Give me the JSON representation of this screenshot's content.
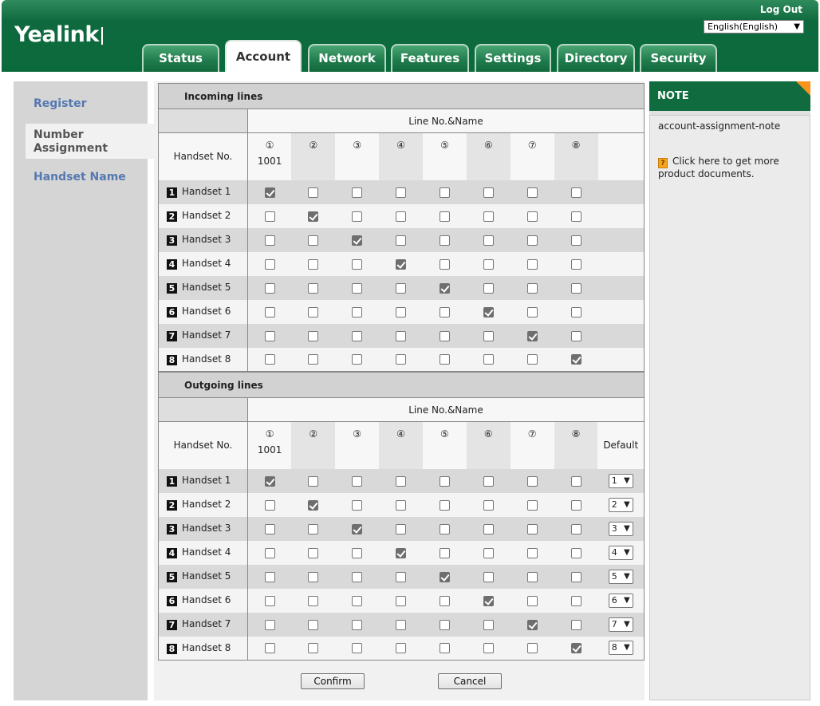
{
  "header": {
    "logo": "Yealink",
    "logout": "Log Out",
    "language": "English(English)",
    "tabs": [
      "Status",
      "Account",
      "Network",
      "Features",
      "Settings",
      "Directory",
      "Security"
    ],
    "active_tab": "Account"
  },
  "sidebar": {
    "items": [
      "Register",
      "Number Assignment",
      "Handset Name"
    ],
    "active": "Number Assignment"
  },
  "incoming": {
    "title": "Incoming lines",
    "line_header": "Line No.&Name",
    "handset_header": "Handset No.",
    "lines": [
      "①",
      "②",
      "③",
      "④",
      "⑤",
      "⑥",
      "⑦",
      "⑧"
    ],
    "line_names": [
      "1001",
      "",
      "",
      "",
      "",
      "",
      "",
      ""
    ],
    "handsets": [
      "Handset 1",
      "Handset 2",
      "Handset 3",
      "Handset 4",
      "Handset 5",
      "Handset 6",
      "Handset 7",
      "Handset 8"
    ],
    "handset_numbers": [
      "1",
      "2",
      "3",
      "4",
      "5",
      "6",
      "7",
      "8"
    ],
    "checked": [
      [
        0
      ],
      [
        1
      ],
      [
        2
      ],
      [
        3
      ],
      [
        4
      ],
      [
        5
      ],
      [
        6
      ],
      [
        7
      ]
    ]
  },
  "outgoing": {
    "title": "Outgoing lines",
    "line_header": "Line No.&Name",
    "handset_header": "Handset No.",
    "default_header": "Default",
    "lines": [
      "①",
      "②",
      "③",
      "④",
      "⑤",
      "⑥",
      "⑦",
      "⑧"
    ],
    "line_names": [
      "1001",
      "",
      "",
      "",
      "",
      "",
      "",
      ""
    ],
    "handsets": [
      "Handset 1",
      "Handset 2",
      "Handset 3",
      "Handset 4",
      "Handset 5",
      "Handset 6",
      "Handset 7",
      "Handset 8"
    ],
    "handset_numbers": [
      "1",
      "2",
      "3",
      "4",
      "5",
      "6",
      "7",
      "8"
    ],
    "checked": [
      [
        0
      ],
      [
        1
      ],
      [
        2
      ],
      [
        3
      ],
      [
        4
      ],
      [
        5
      ],
      [
        6
      ],
      [
        7
      ]
    ],
    "defaults": [
      "1",
      "2",
      "3",
      "4",
      "5",
      "6",
      "7",
      "8"
    ]
  },
  "buttons": {
    "confirm": "Confirm",
    "cancel": "Cancel"
  },
  "note": {
    "title": "NOTE",
    "text": "account-assignment-note",
    "link": "Click here to get more product documents.",
    "link_icon": "help-icon"
  }
}
